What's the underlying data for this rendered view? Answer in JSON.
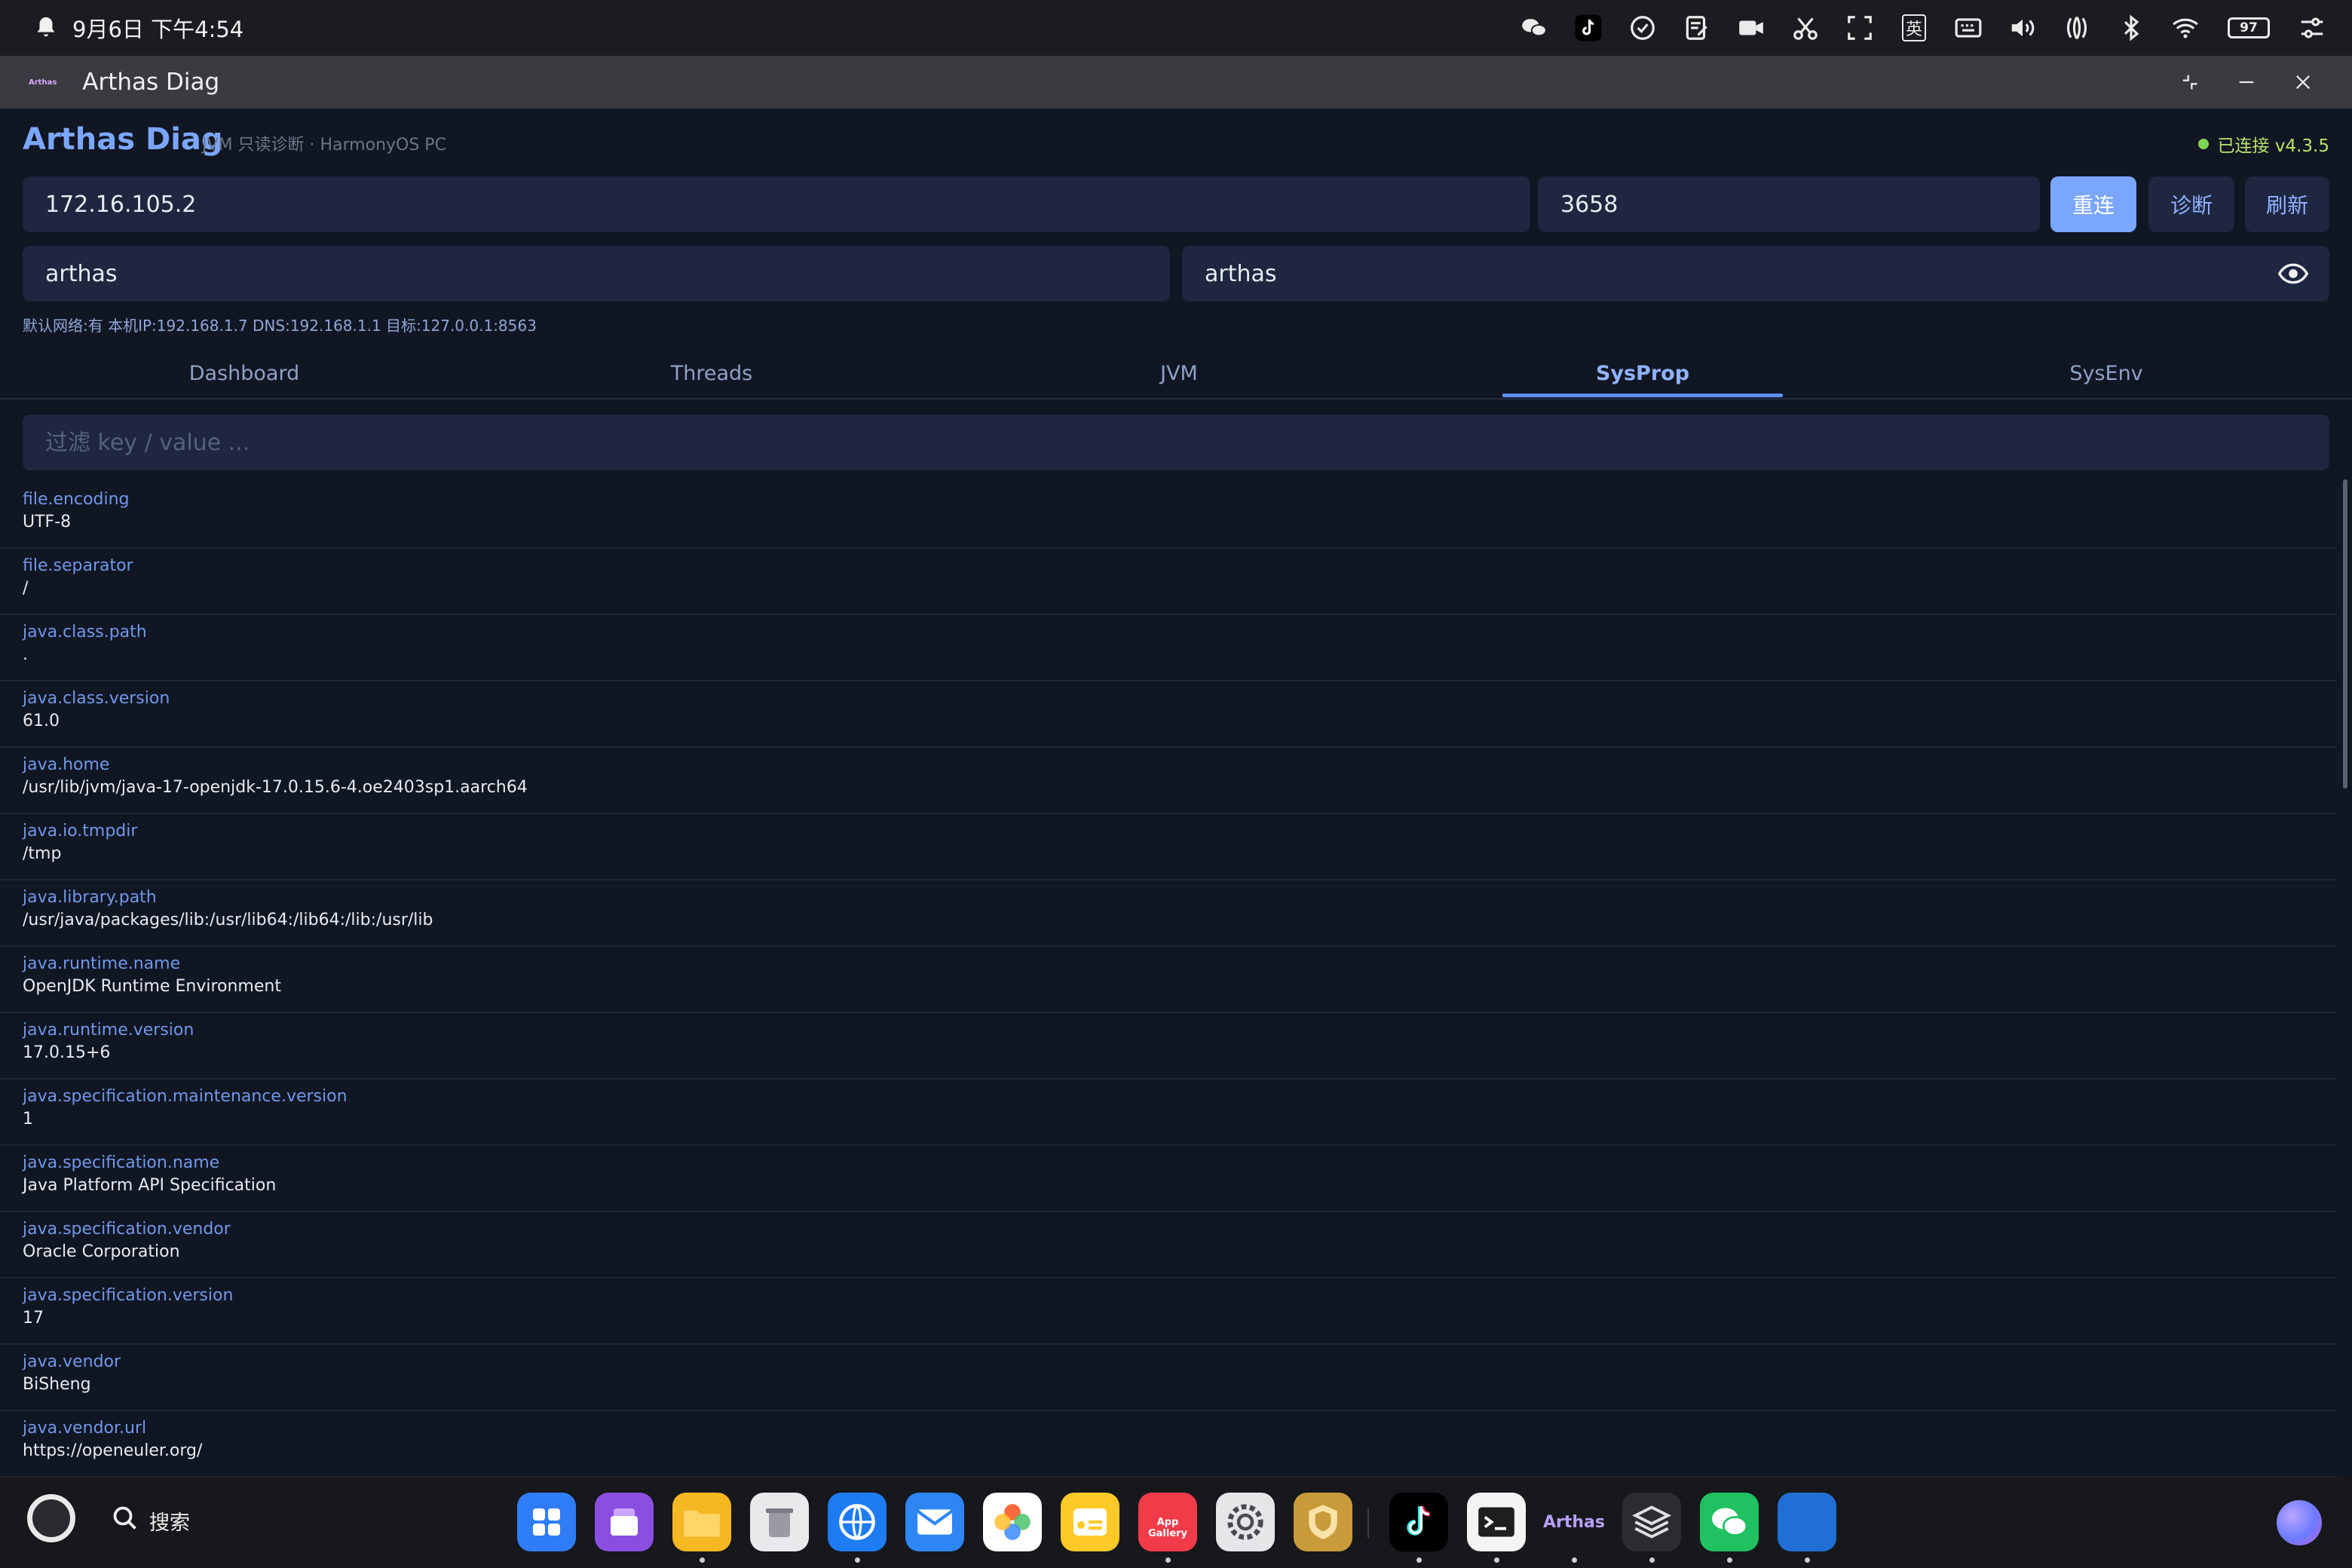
{
  "status_bar": {
    "datetime": "9月6日 下午4:54",
    "ime_label": "英",
    "battery": "97"
  },
  "window": {
    "title": "Arthas Diag",
    "logo_text": "Arthas"
  },
  "header": {
    "title": "Arthas Diag",
    "subtitle": "JVM 只读诊断 · HarmonyOS PC",
    "connection_status": "已连接 v4.3.5"
  },
  "connection": {
    "host": "172.16.105.2",
    "port": "3658",
    "username": "arthas",
    "password": "arthas",
    "reconnect_label": "重连",
    "diagnose_label": "诊断",
    "refresh_label": "刷新",
    "net_info": "默认网络:有  本机IP:192.168.1.7  DNS:192.168.1.1  目标:127.0.0.1:8563"
  },
  "tabs": [
    {
      "label": "Dashboard"
    },
    {
      "label": "Threads"
    },
    {
      "label": "JVM"
    },
    {
      "label": "SysProp"
    },
    {
      "label": "SysEnv"
    }
  ],
  "active_tab": "SysProp",
  "filter": {
    "placeholder": "过滤 key / value ..."
  },
  "properties": [
    {
      "key": "file.encoding",
      "value": "UTF-8"
    },
    {
      "key": "file.separator",
      "value": "/"
    },
    {
      "key": "java.class.path",
      "value": "."
    },
    {
      "key": "java.class.version",
      "value": "61.0"
    },
    {
      "key": "java.home",
      "value": "/usr/lib/jvm/java-17-openjdk-17.0.15.6-4.oe2403sp1.aarch64"
    },
    {
      "key": "java.io.tmpdir",
      "value": "/tmp"
    },
    {
      "key": "java.library.path",
      "value": "/usr/java/packages/lib:/usr/lib64:/lib64:/lib:/usr/lib"
    },
    {
      "key": "java.runtime.name",
      "value": "OpenJDK Runtime Environment"
    },
    {
      "key": "java.runtime.version",
      "value": "17.0.15+6"
    },
    {
      "key": "java.specification.maintenance.version",
      "value": "1"
    },
    {
      "key": "java.specification.name",
      "value": "Java Platform API Specification"
    },
    {
      "key": "java.specification.vendor",
      "value": "Oracle Corporation"
    },
    {
      "key": "java.specification.version",
      "value": "17"
    },
    {
      "key": "java.vendor",
      "value": "BiSheng"
    },
    {
      "key": "java.vendor.url",
      "value": "https://openeuler.org/"
    }
  ],
  "taskbar": {
    "search_label": "搜索",
    "app_gallery_label": "App Gallery",
    "arthas_label": "Arthas"
  },
  "colors": {
    "accent": "#7ba6ff",
    "background": "#111623",
    "field": "#1e2640",
    "key_text": "#6f98ea",
    "connected": "#7fd654"
  }
}
